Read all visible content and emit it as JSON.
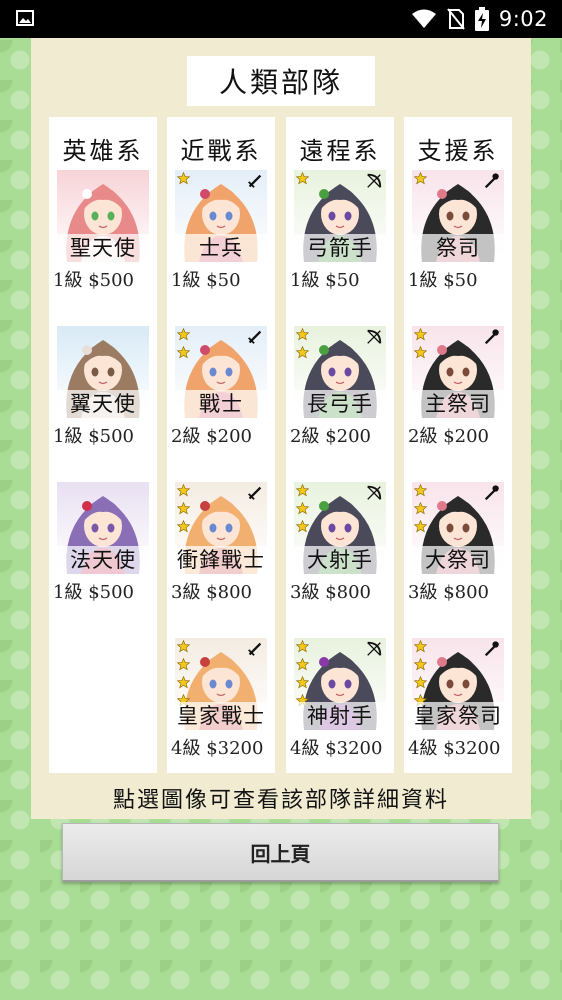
{
  "status_bar": {
    "time": "9:02",
    "icons": [
      "gallery-icon",
      "wifi-icon",
      "no-sim-icon",
      "battery-charging-icon"
    ]
  },
  "title": "人類部隊",
  "columns": [
    {
      "header": "英雄系",
      "units": [
        {
          "name": "聖天使",
          "level": "1級",
          "price": "$500",
          "stars": 0,
          "weapon": "",
          "portrait": {
            "hair": "#e98a8a",
            "bg": "#f7d3d7",
            "eye": "#58b058",
            "accent": "#ffffff"
          }
        },
        {
          "name": "翼天使",
          "level": "1級",
          "price": "$500",
          "stars": 0,
          "weapon": "",
          "portrait": {
            "hair": "#9b7b62",
            "bg": "#d8eaf6",
            "eye": "#7a5a44",
            "accent": "#e8e0d8"
          }
        },
        {
          "name": "法天使",
          "level": "1級",
          "price": "$500",
          "stars": 0,
          "weapon": "",
          "portrait": {
            "hair": "#8a6fb6",
            "bg": "#e9e0f2",
            "eye": "#7a5aa8",
            "accent": "#d0304a"
          }
        }
      ]
    },
    {
      "header": "近戰系",
      "units": [
        {
          "name": "士兵",
          "level": "1級",
          "price": "$50",
          "stars": 1,
          "weapon": "sword-icon",
          "portrait": {
            "hair": "#f0a36a",
            "bg": "#e4eef8",
            "eye": "#6a8ad0",
            "accent": "#d04a6a"
          }
        },
        {
          "name": "戰士",
          "level": "2級",
          "price": "$200",
          "stars": 2,
          "weapon": "sword-icon",
          "portrait": {
            "hair": "#f0a36a",
            "bg": "#e4eef8",
            "eye": "#6a8ad0",
            "accent": "#d04a6a"
          }
        },
        {
          "name": "衝鋒戰士",
          "level": "3級",
          "price": "$800",
          "stars": 3,
          "weapon": "sword-icon",
          "portrait": {
            "hair": "#f2b070",
            "bg": "#f4ece2",
            "eye": "#6a8ad0",
            "accent": "#c64040"
          }
        },
        {
          "name": "皇家戰士",
          "level": "4級",
          "price": "$3200",
          "stars": 4,
          "weapon": "sword-icon",
          "portrait": {
            "hair": "#f2b070",
            "bg": "#f4ece2",
            "eye": "#6a8ad0",
            "accent": "#c64040"
          }
        }
      ]
    },
    {
      "header": "遠程系",
      "units": [
        {
          "name": "弓箭手",
          "level": "1級",
          "price": "$50",
          "stars": 1,
          "weapon": "bow-icon",
          "portrait": {
            "hair": "#4a4a5a",
            "bg": "#e8f2de",
            "eye": "#6a4aa0",
            "accent": "#4aa040"
          }
        },
        {
          "name": "長弓手",
          "level": "2級",
          "price": "$200",
          "stars": 2,
          "weapon": "bow-icon",
          "portrait": {
            "hair": "#4a4a5a",
            "bg": "#e8f2de",
            "eye": "#6a4aa0",
            "accent": "#4aa040"
          }
        },
        {
          "name": "大射手",
          "level": "3級",
          "price": "$800",
          "stars": 3,
          "weapon": "bow-icon",
          "portrait": {
            "hair": "#4a4a5a",
            "bg": "#e8f2de",
            "eye": "#6a4aa0",
            "accent": "#4aa040"
          }
        },
        {
          "name": "神射手",
          "level": "4級",
          "price": "$3200",
          "stars": 4,
          "weapon": "bow-icon",
          "portrait": {
            "hair": "#4a4a5a",
            "bg": "#e8f2de",
            "eye": "#6a4aa0",
            "accent": "#8a3aa8"
          }
        }
      ]
    },
    {
      "header": "支援系",
      "units": [
        {
          "name": "祭司",
          "level": "1級",
          "price": "$50",
          "stars": 1,
          "weapon": "wand-icon",
          "portrait": {
            "hair": "#2a2a2a",
            "bg": "#f8e4ea",
            "eye": "#7a4a3a",
            "accent": "#e07a8a"
          }
        },
        {
          "name": "主祭司",
          "level": "2級",
          "price": "$200",
          "stars": 2,
          "weapon": "wand-icon",
          "portrait": {
            "hair": "#2a2a2a",
            "bg": "#f8e4ea",
            "eye": "#7a4a3a",
            "accent": "#e07a8a"
          }
        },
        {
          "name": "大祭司",
          "level": "3級",
          "price": "$800",
          "stars": 3,
          "weapon": "wand-icon",
          "portrait": {
            "hair": "#2a2a2a",
            "bg": "#f8e4ea",
            "eye": "#7a4a3a",
            "accent": "#e07a8a"
          }
        },
        {
          "name": "皇家祭司",
          "level": "4級",
          "price": "$3200",
          "stars": 4,
          "weapon": "wand-icon",
          "portrait": {
            "hair": "#2a2a2a",
            "bg": "#f8e4ea",
            "eye": "#7a4a3a",
            "accent": "#e07a8a"
          }
        }
      ]
    }
  ],
  "footer_hint": "點選圖像可查看該部隊詳細資料",
  "back_button": "回上頁",
  "colors": {
    "background": "#a9dc94",
    "panel": "#f1ebd2",
    "star": "#f4c81a"
  }
}
